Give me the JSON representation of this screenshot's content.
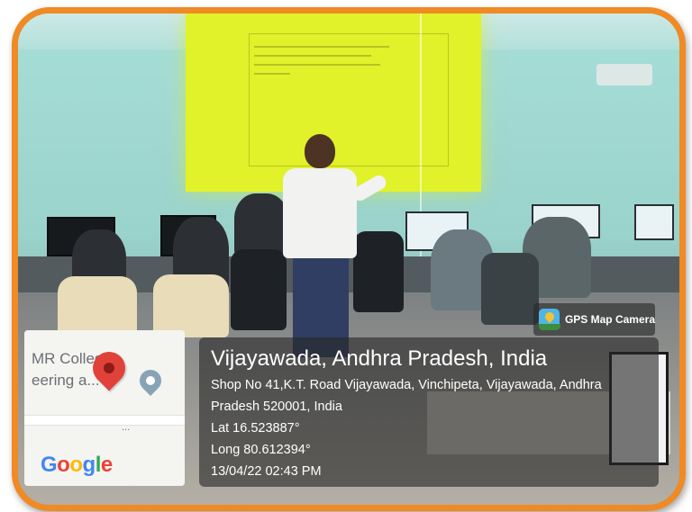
{
  "photo": {
    "description_icon": "classroom-photo",
    "frame_color": "#f08a24"
  },
  "map": {
    "place_line1": "MR College",
    "place_line2": "eering a...",
    "dots": "...",
    "logo": [
      "G",
      "o",
      "o",
      "g",
      "l",
      "e"
    ],
    "logo_colors": [
      "#4285f4",
      "#ea4335",
      "#fbbc05",
      "#4285f4",
      "#34a853",
      "#ea4335"
    ],
    "pin_icon": "red-map-pin-icon"
  },
  "badge": {
    "label": "GPS Map Camera",
    "icon": "gps-map-camera-icon"
  },
  "location": {
    "title": "Vijayawada, Andhra Pradesh, India",
    "address_line1": "Shop No 41,K.T. Road Vijayawada, Vinchipeta, Vijayawada, Andhra",
    "address_line2": "Pradesh 520001, India",
    "lat": "Lat 16.523887°",
    "long": "Long 80.612394°",
    "datetime": "13/04/22 02:43 PM"
  }
}
